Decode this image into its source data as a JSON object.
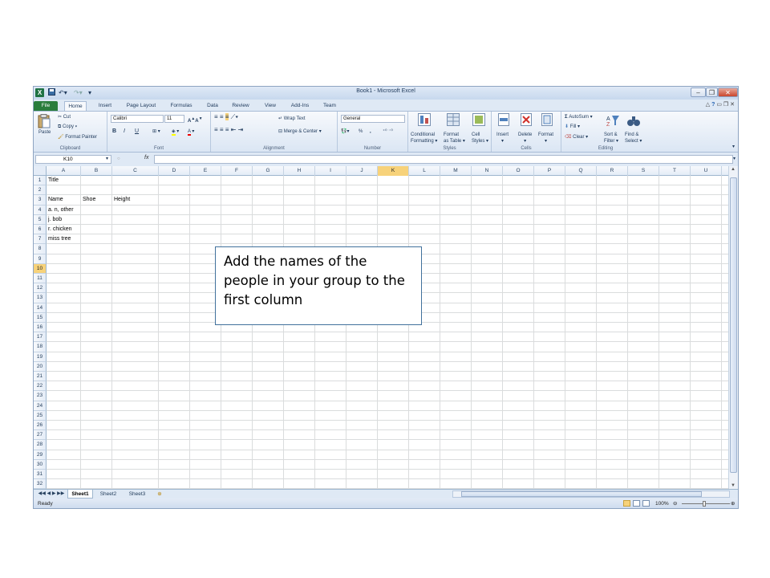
{
  "window": {
    "title": "Book1 - Microsoft Excel",
    "app_icon": "X"
  },
  "tabs": [
    "File",
    "Home",
    "Insert",
    "Page Layout",
    "Formulas",
    "Data",
    "Review",
    "View",
    "Add-Ins",
    "Team"
  ],
  "ribbon": {
    "clipboard": {
      "paste": "Paste",
      "cut": "Cut",
      "copy": "Copy",
      "format_painter": "Format Painter",
      "label": "Clipboard"
    },
    "font": {
      "name": "Calibri",
      "size": "11",
      "bold": "B",
      "italic": "I",
      "underline": "U",
      "label": "Font"
    },
    "alignment": {
      "wrap": "Wrap Text",
      "merge": "Merge & Center",
      "label": "Alignment"
    },
    "number": {
      "format": "General",
      "percent": "%",
      "comma": ",",
      "label": "Number"
    },
    "styles": {
      "conditional": "Conditional",
      "conditional2": "Formatting",
      "format_as": "Format",
      "format_as2": "as Table",
      "cell": "Cell",
      "cell2": "Styles",
      "label": "Styles"
    },
    "cells": {
      "insert": "Insert",
      "delete": "Delete",
      "format": "Format",
      "label": "Cells"
    },
    "editing": {
      "autosum": "AutoSum",
      "fill": "Fill",
      "clear": "Clear",
      "sort": "Sort &",
      "sort2": "Filter",
      "find": "Find &",
      "find2": "Select",
      "label": "Editing"
    }
  },
  "formula_bar": {
    "name_box": "K10",
    "fx": "fx",
    "value": ""
  },
  "grid": {
    "columns": [
      "A",
      "B",
      "C",
      "D",
      "E",
      "F",
      "G",
      "H",
      "I",
      "J",
      "K",
      "L",
      "M",
      "N",
      "O",
      "P",
      "Q",
      "R",
      "S",
      "T",
      "U"
    ],
    "rows": [
      "1",
      "2",
      "3",
      "4",
      "5",
      "6",
      "7",
      "8",
      "9",
      "10",
      "11",
      "12",
      "13",
      "14",
      "15",
      "16",
      "17",
      "18",
      "19",
      "20",
      "21",
      "22",
      "23",
      "24",
      "25",
      "26",
      "27",
      "28",
      "29",
      "30",
      "31",
      "32"
    ],
    "selected_column": "K",
    "selected_row": "10",
    "cells": {
      "A1": "Title",
      "A3": "Name",
      "B3": "Shoe",
      "C3": "Height",
      "A4": "a. n, other",
      "A5": "j. bob",
      "A6": "r. chicken",
      "A7": "miss tree"
    }
  },
  "sheets": [
    "Sheet1",
    "Sheet2",
    "Sheet3"
  ],
  "status": {
    "ready": "Ready",
    "zoom": "100%"
  },
  "callout": {
    "text": "Add the names of the people in your group to the first column"
  }
}
